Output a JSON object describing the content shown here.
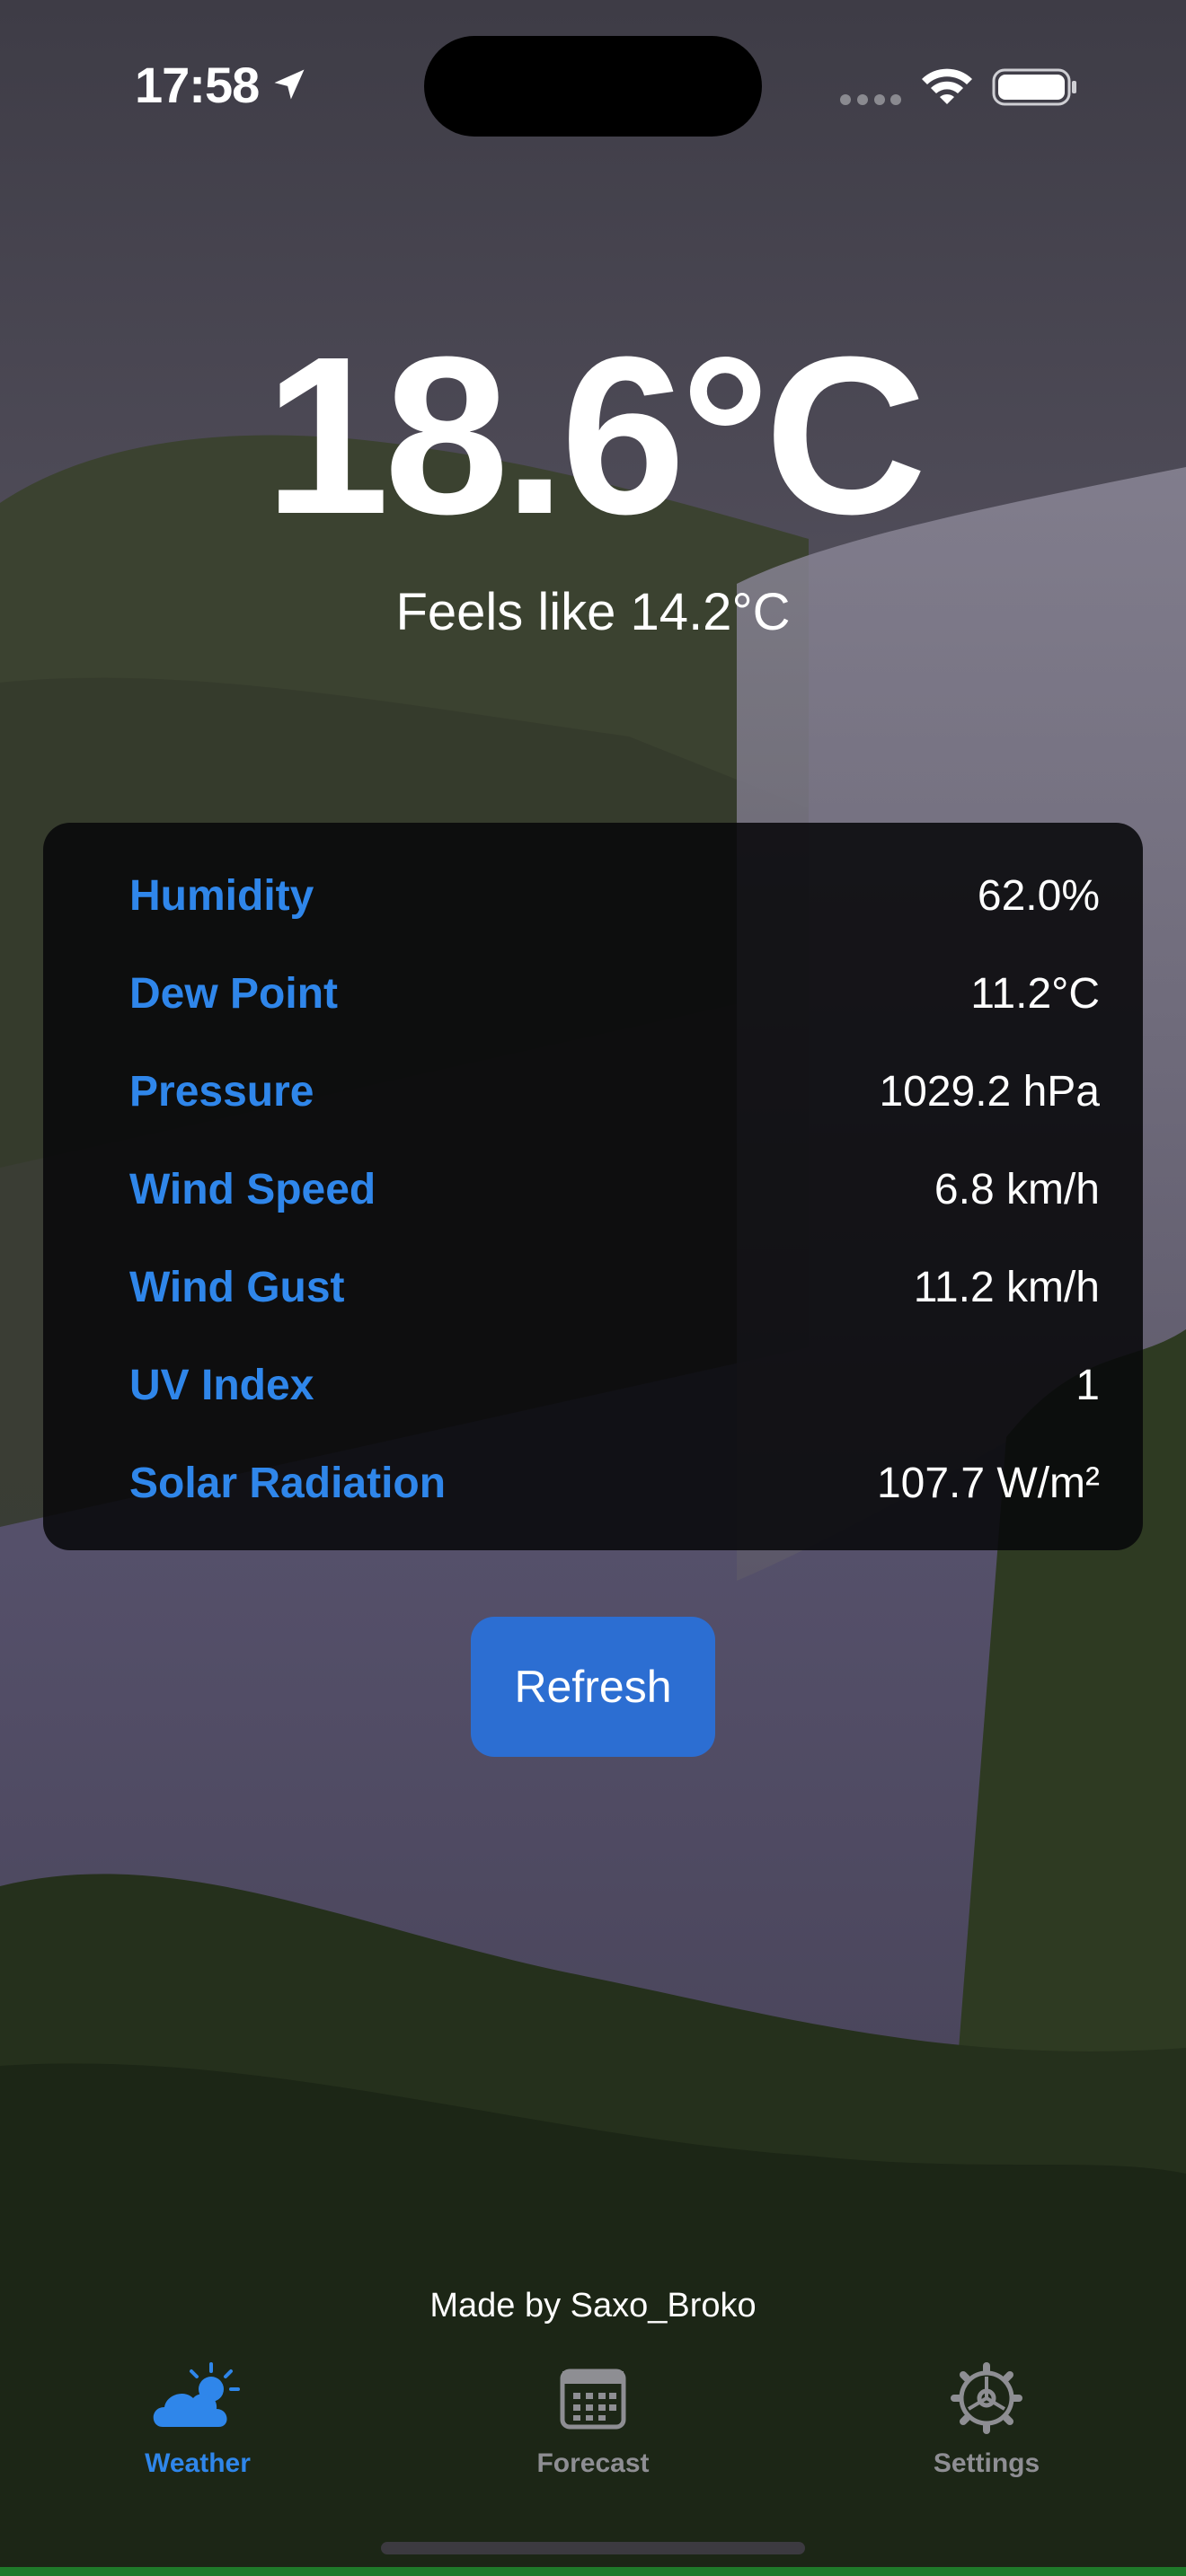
{
  "status_bar": {
    "time": "17:58"
  },
  "weather": {
    "temperature": "18.6°C",
    "feels_like": "Feels like 14.2°C"
  },
  "details": [
    {
      "label": "Humidity",
      "value": "62.0%"
    },
    {
      "label": "Dew Point",
      "value": "11.2°C"
    },
    {
      "label": "Pressure",
      "value": "1029.2 hPa"
    },
    {
      "label": "Wind Speed",
      "value": "6.8 km/h"
    },
    {
      "label": "Wind Gust",
      "value": "11.2 km/h"
    },
    {
      "label": "UV Index",
      "value": "1"
    },
    {
      "label": "Solar Radiation",
      "value": "107.7 W/m²"
    }
  ],
  "refresh_label": "Refresh",
  "credit": "Made by Saxo_Broko",
  "tabs": [
    {
      "label": "Weather",
      "icon": "cloud-sun-icon",
      "active": true
    },
    {
      "label": "Forecast",
      "icon": "calendar-icon",
      "active": false
    },
    {
      "label": "Settings",
      "icon": "gear-icon",
      "active": false
    }
  ],
  "colors": {
    "accent": "#2f86ea",
    "button": "#2c6ed2",
    "card_background": "#08080a",
    "inactive_tab": "#8e8e93"
  }
}
